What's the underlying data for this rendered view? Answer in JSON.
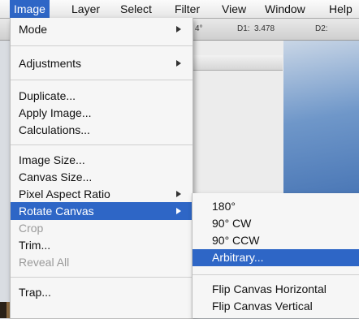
{
  "menubar": {
    "items": [
      "Image",
      "Layer",
      "Select",
      "Filter",
      "View",
      "Window",
      "Help"
    ]
  },
  "options_bar": {
    "angle": "4°",
    "d1_label": "D1:",
    "d1_value": "3.478",
    "d2_label": "D2:"
  },
  "image_menu": {
    "mode": "Mode",
    "adjustments": "Adjustments",
    "duplicate": "Duplicate...",
    "apply_image": "Apply Image...",
    "calculations": "Calculations...",
    "image_size": "Image Size...",
    "canvas_size": "Canvas Size...",
    "pixel_aspect_ratio": "Pixel Aspect Ratio",
    "rotate_canvas": "Rotate Canvas",
    "crop": "Crop",
    "trim": "Trim...",
    "reveal_all": "Reveal All",
    "trap": "Trap..."
  },
  "rotate_submenu": {
    "r180": "180°",
    "r90cw": "90° CW",
    "r90ccw": "90° CCW",
    "arbitrary": "Arbitrary...",
    "flip_h": "Flip Canvas Horizontal",
    "flip_v": "Flip Canvas Vertical"
  },
  "colors": {
    "highlight": "#2e66c6",
    "disabled_text": "#9a9a9a"
  }
}
